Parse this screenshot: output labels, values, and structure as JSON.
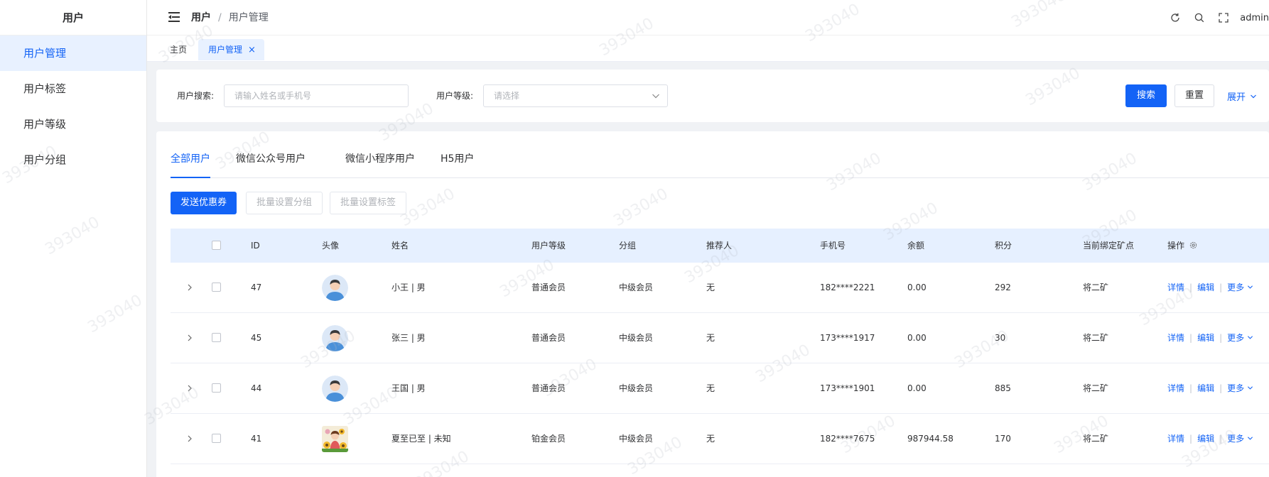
{
  "sidebar": {
    "title": "用户",
    "items": [
      {
        "label": "用户管理",
        "active": true
      },
      {
        "label": "用户标签",
        "active": false
      },
      {
        "label": "用户等级",
        "active": false
      },
      {
        "label": "用户分组",
        "active": false
      }
    ]
  },
  "header": {
    "breadcrumb_root": "用户",
    "breadcrumb_sep": "/",
    "breadcrumb_current": "用户管理",
    "user": "admin"
  },
  "tagsbar": {
    "home": "主页",
    "active": "用户管理",
    "close": "×"
  },
  "search": {
    "user_search_label": "用户搜索:",
    "user_search_placeholder": "请输入姓名或手机号",
    "level_label": "用户等级:",
    "level_placeholder": "请选择",
    "search_button": "搜索",
    "reset_button": "重置",
    "expand": "展开"
  },
  "tabs": [
    {
      "label": "全部用户",
      "active": true
    },
    {
      "label": "微信公众号用户",
      "active": false
    },
    {
      "label": "微信小程序用户",
      "active": false
    },
    {
      "label": "H5用户",
      "active": false
    }
  ],
  "actions": {
    "send_coupon": "发送优惠券",
    "batch_group": "批量设置分组",
    "batch_tag": "批量设置标签"
  },
  "table": {
    "columns": {
      "id": "ID",
      "avatar": "头像",
      "name": "姓名",
      "level": "用户等级",
      "group": "分组",
      "referrer": "推荐人",
      "phone": "手机号",
      "balance": "余额",
      "points": "积分",
      "mine": "当前绑定矿点",
      "ops": "操作"
    },
    "rows": [
      {
        "id": "47",
        "avatar": "default",
        "name": "小王 | 男",
        "level": "普通会员",
        "group": "中级会员",
        "referrer": "无",
        "phone": "182****2221",
        "balance": "0.00",
        "points": "292",
        "mine": "将二矿"
      },
      {
        "id": "45",
        "avatar": "default",
        "name": "张三 | 男",
        "level": "普通会员",
        "group": "中级会员",
        "referrer": "无",
        "phone": "173****1917",
        "balance": "0.00",
        "points": "30",
        "mine": "将二矿"
      },
      {
        "id": "44",
        "avatar": "default",
        "name": "王国 | 男",
        "level": "普通会员",
        "group": "中级会员",
        "referrer": "无",
        "phone": "173****1901",
        "balance": "0.00",
        "points": "885",
        "mine": "将二矿"
      },
      {
        "id": "41",
        "avatar": "photo",
        "name": "夏至已至 | 未知",
        "level": "铂金会员",
        "group": "中级会员",
        "referrer": "无",
        "phone": "182****7675",
        "balance": "987944.58",
        "points": "170",
        "mine": "将二矿"
      }
    ],
    "ops": {
      "detail": "详情",
      "edit": "编辑",
      "more": "更多"
    }
  },
  "watermark": "393040",
  "colors": {
    "primary": "#1363f6",
    "active_bg": "#e8f1ff"
  }
}
